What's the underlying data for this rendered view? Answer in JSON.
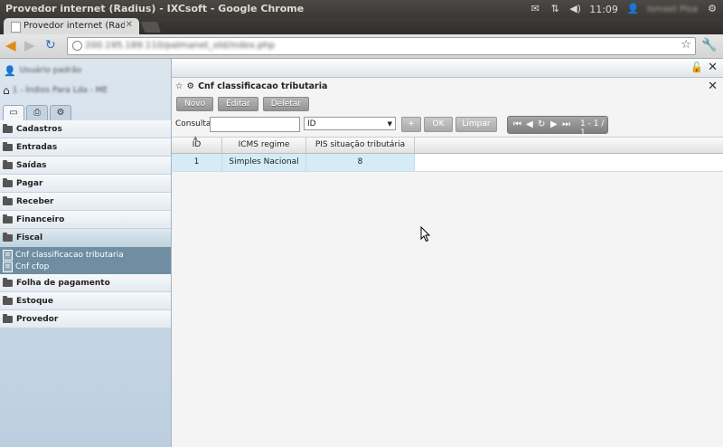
{
  "os_bar": {
    "window_title": "Provedor internet (Radius) - IXCsoft - Google Chrome",
    "time": "11:09",
    "user": "Ismael Pisa",
    "tray_icons": [
      "mail-icon",
      "network-icon",
      "volume-icon",
      "user-icon",
      "gear-icon"
    ]
  },
  "browser": {
    "tab_title": "Provedor internet (Radius",
    "url": "200.195.189.110/palmanet_old/index.php"
  },
  "sidebar": {
    "user": "Usuário padrão",
    "company": "1 - Índios Para Lda - ME",
    "tabs": [
      "window-icon",
      "print-icon",
      "gear-icon"
    ],
    "menu": [
      {
        "label": "Cadastros"
      },
      {
        "label": "Entradas"
      },
      {
        "label": "Saídas"
      },
      {
        "label": "Pagar"
      },
      {
        "label": "Receber"
      },
      {
        "label": "Financeiro"
      },
      {
        "label": "Fiscal",
        "open": true
      },
      {
        "label": "Folha de pagamento"
      },
      {
        "label": "Estoque"
      },
      {
        "label": "Provedor"
      }
    ],
    "fiscal_sub": [
      "Cnf classificacao tributaria",
      "Cnf cfop"
    ]
  },
  "window": {
    "title": "Cnf classificacao tributaria",
    "buttons": {
      "novo": "Novo",
      "editar": "Editar",
      "deletar": "Deletar"
    },
    "search": {
      "label": "Consultar",
      "value": "",
      "field_select": "ID",
      "plus": "+",
      "ok": "OK",
      "clear": "Limpar"
    },
    "pager": {
      "count": "1 - 1 / 1"
    }
  },
  "grid": {
    "columns": [
      "ID",
      "ICMS regime",
      "PIS situação tributária"
    ],
    "rows": [
      [
        "1",
        "Simples Nacional",
        "8"
      ]
    ]
  }
}
